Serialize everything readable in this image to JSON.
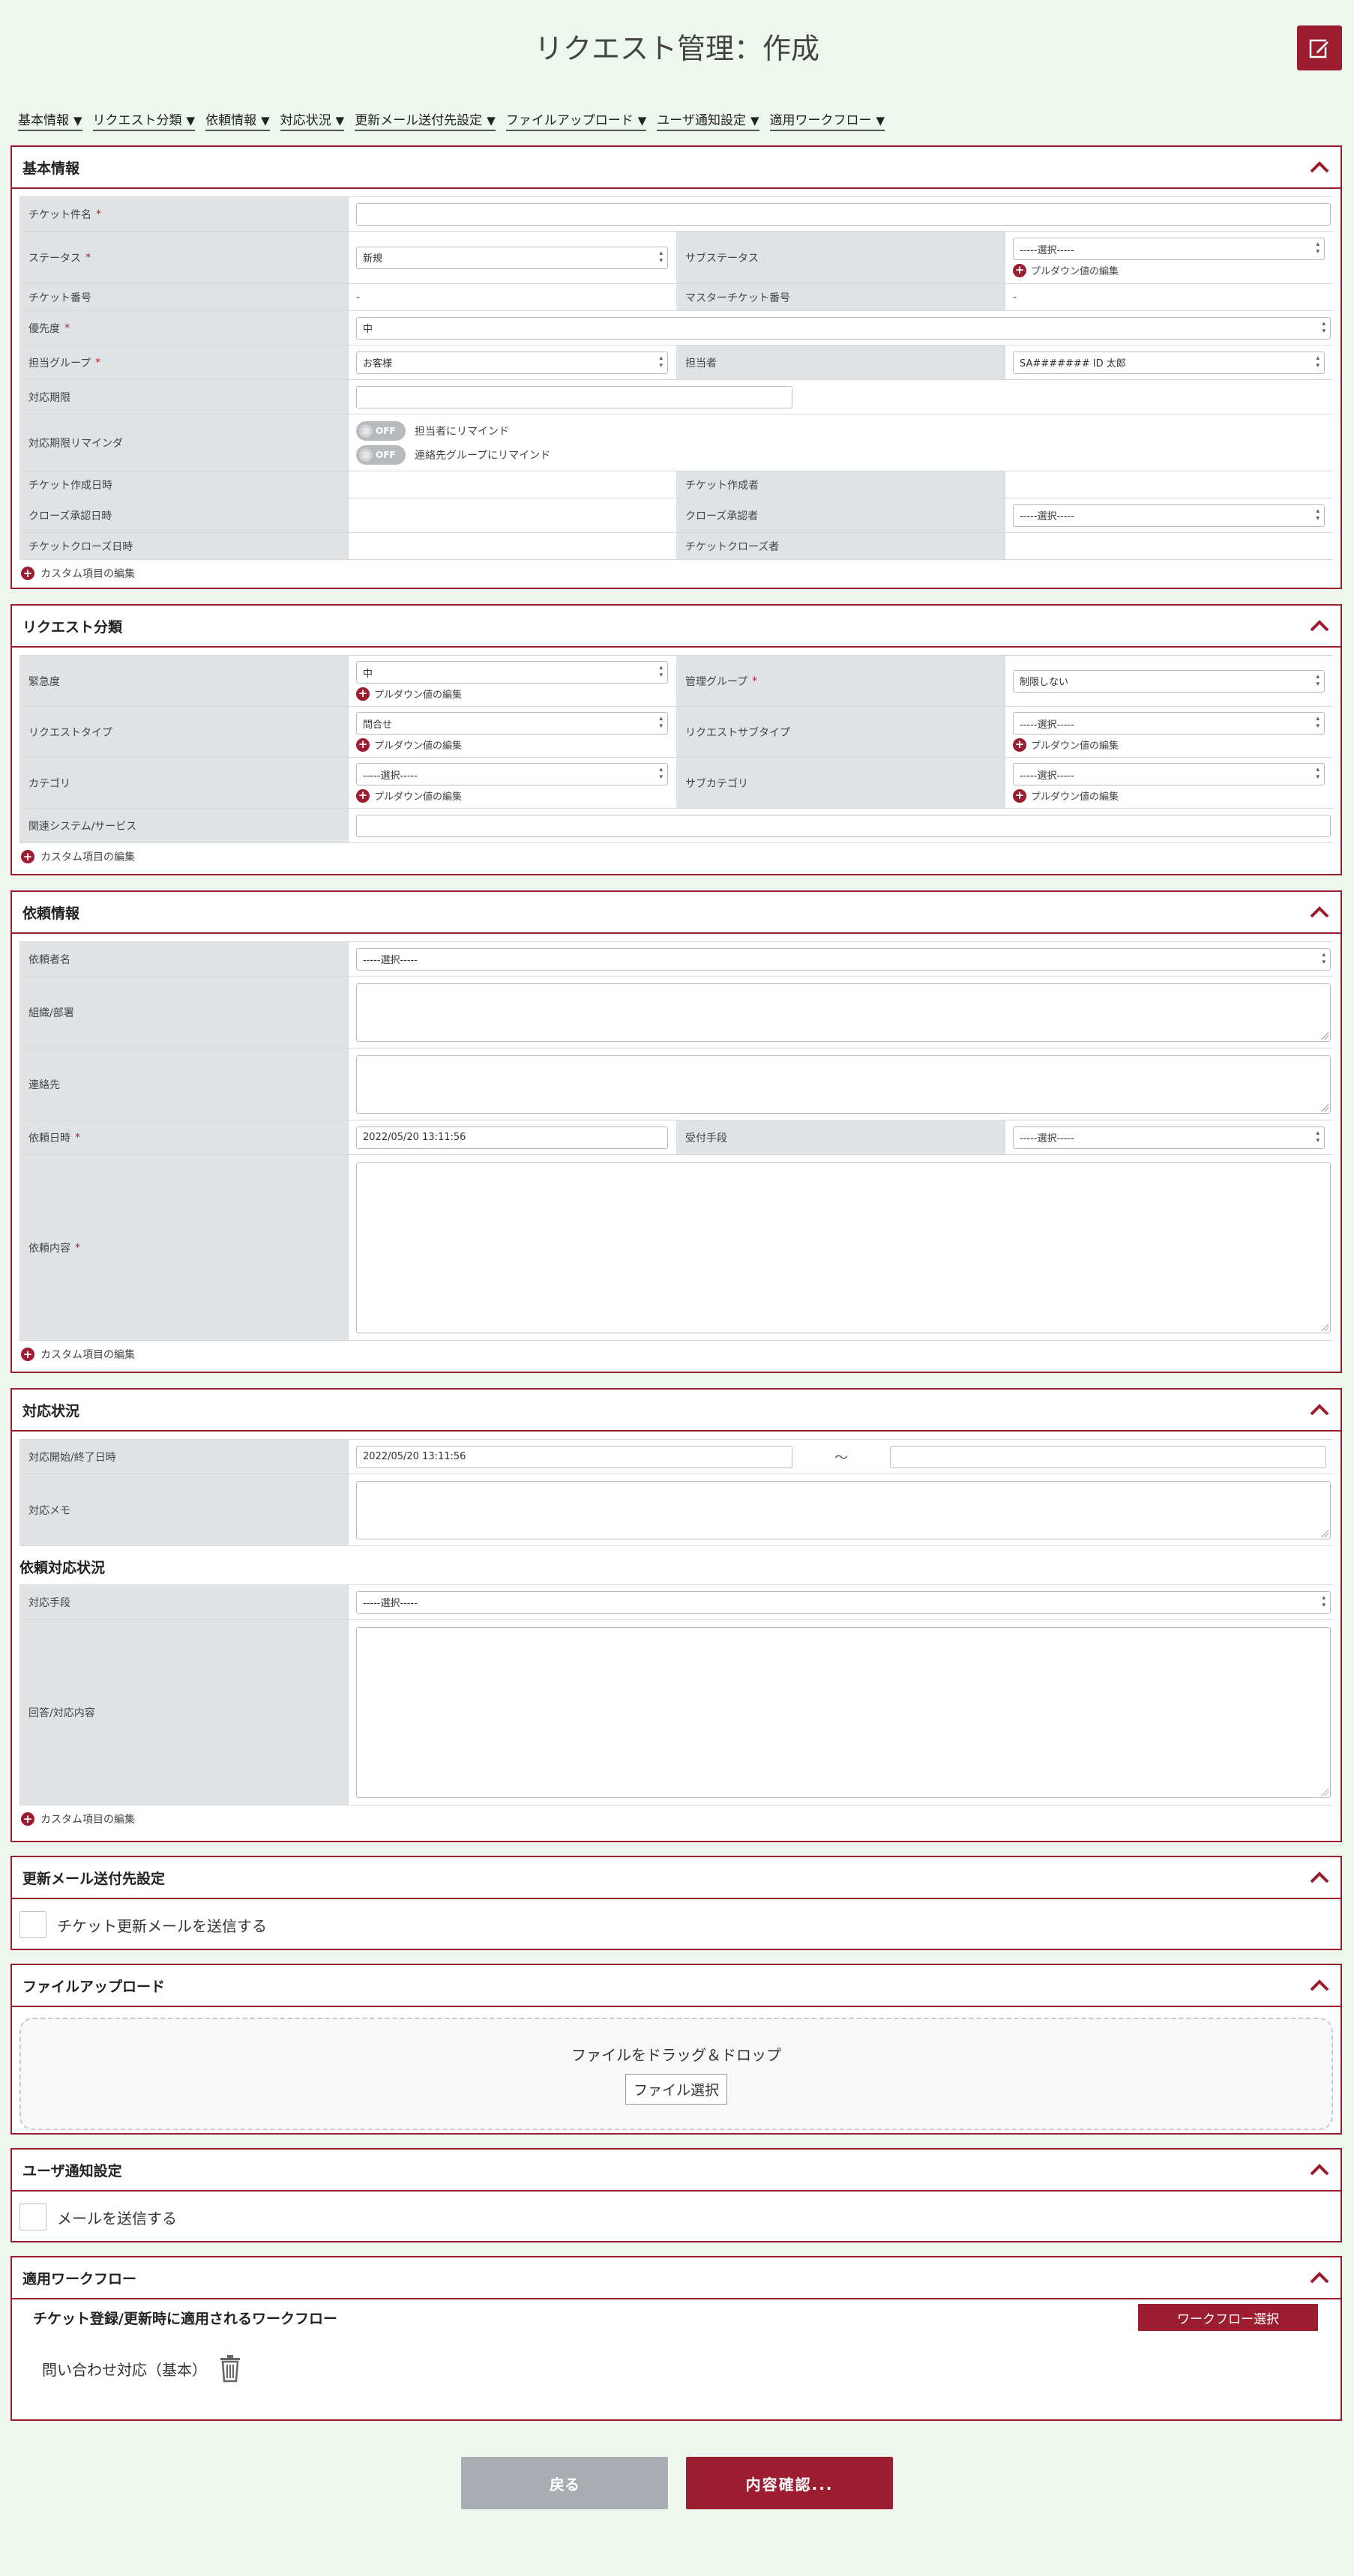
{
  "page": {
    "title": "リクエスト管理：作成"
  },
  "nav": {
    "items": [
      "基本情報",
      "リクエスト分類",
      "依頼情報",
      "対応状況",
      "更新メール送付先設定",
      "ファイルアップロード",
      "ユーザ通知設定",
      "適用ワークフロー"
    ],
    "arrow": "▼"
  },
  "common": {
    "custom_edit": "カスタム項目の編集",
    "pulldown_edit": "プルダウン値の編集",
    "select_placeholder": "-----選択-----",
    "required": "*"
  },
  "basic": {
    "title": "基本情報",
    "ticket_name": "チケット件名",
    "status": "ステータス",
    "status_value": "新規",
    "sub_status": "サブステータス",
    "ticket_no": "チケット番号",
    "ticket_no_value": "-",
    "master_ticket_no": "マスターチケット番号",
    "master_ticket_no_value": "-",
    "priority": "優先度",
    "priority_value": "中",
    "group": "担当グループ",
    "group_value": "お客様",
    "assignee": "担当者",
    "assignee_value": "SA####### ID 太郎",
    "deadline": "対応期限",
    "deadline_reminder": "対応期限リマインダ",
    "toggle_off": "OFF",
    "remind_assignee": "担当者にリマインド",
    "remind_group": "連絡先グループにリマインド",
    "created_at": "チケット作成日時",
    "creator": "チケット作成者",
    "close_approved_at": "クローズ承認日時",
    "close_approver": "クローズ承認者",
    "closed_at": "チケットクローズ日時",
    "closer": "チケットクローズ者"
  },
  "classification": {
    "title": "リクエスト分類",
    "urgency": "緊急度",
    "urgency_value": "中",
    "mgmt_group": "管理グループ",
    "mgmt_group_value": "制限しない",
    "req_type": "リクエストタイプ",
    "req_type_value": "問合せ",
    "req_subtype": "リクエストサブタイプ",
    "category": "カテゴリ",
    "subcategory": "サブカテゴリ",
    "related_system": "関連システム/サービス"
  },
  "request": {
    "title": "依頼情報",
    "requester": "依頼者名",
    "org": "組織/部署",
    "contact": "連絡先",
    "requested_at": "依頼日時",
    "requested_at_value": "2022/05/20 13:11:56",
    "reception": "受付手段",
    "content": "依頼内容"
  },
  "response": {
    "title": "対応状況",
    "period": "対応開始/終了日時",
    "period_start": "2022/05/20 13:11:56",
    "tilde": "～",
    "memo": "対応メモ",
    "sub_title": "依頼対応状況",
    "method": "対応手段",
    "answer": "回答/対応内容"
  },
  "mail": {
    "title": "更新メール送付先設定",
    "checkbox": "チケット更新メールを送信する"
  },
  "upload": {
    "title": "ファイルアップロード",
    "drop_text": "ファイルをドラッグ＆ドロップ",
    "button": "ファイル選択"
  },
  "notify": {
    "title": "ユーザ通知設定",
    "checkbox": "メールを送信する"
  },
  "workflow": {
    "title": "適用ワークフロー",
    "caption": "チケット登録/更新時に適用されるワークフロー",
    "select_button": "ワークフロー選択",
    "item": "問い合わせ対応（基本）"
  },
  "footer": {
    "back": "戻る",
    "confirm": "内容確認..."
  },
  "colors": {
    "accent": "#9c1c30",
    "background": "#eef7ee",
    "label_bg": "#dfe3e6"
  }
}
